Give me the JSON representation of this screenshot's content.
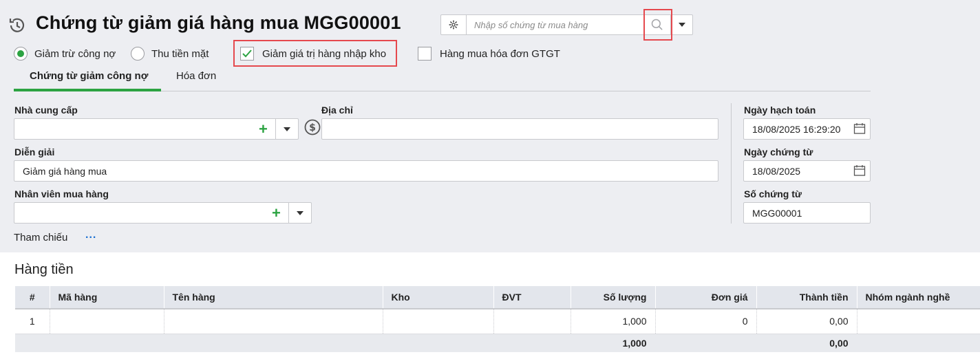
{
  "header": {
    "title": "Chứng từ giảm giá hàng mua MGG00001"
  },
  "search": {
    "placeholder": "Nhập số chứng từ mua hàng"
  },
  "options": {
    "radio_debt": "Giảm trừ công nợ",
    "radio_cash": "Thu tiền mặt",
    "check_stock": "Giảm giá trị hàng nhập kho",
    "check_vat": "Hàng mua hóa đơn GTGT",
    "radio_debt_selected": true,
    "check_stock_checked": true,
    "check_vat_checked": false
  },
  "tabs": [
    {
      "label": "Chứng từ giảm công nợ",
      "active": true
    },
    {
      "label": "Hóa đơn",
      "active": false
    }
  ],
  "form": {
    "supplier_label": "Nhà cung cấp",
    "supplier_value": "",
    "address_label": "Địa chỉ",
    "address_value": "",
    "description_label": "Diễn giải",
    "description_value": "Giảm giá hàng mua",
    "staff_label": "Nhân viên mua hàng",
    "staff_value": "",
    "posting_date_label": "Ngày hạch toán",
    "posting_date_value": "18/08/2025 16:29:20",
    "voucher_date_label": "Ngày chứng từ",
    "voucher_date_value": "18/08/2025",
    "voucher_no_label": "Số chứng từ",
    "voucher_no_value": "MGG00001",
    "reference_label": "Tham chiếu",
    "reference_more": "..."
  },
  "grid": {
    "title": "Hàng tiền",
    "columns": [
      "#",
      "Mã hàng",
      "Tên hàng",
      "Kho",
      "ĐVT",
      "Số lượng",
      "Đơn giá",
      "Thành tiền",
      "Nhóm ngành nghề"
    ],
    "rows": [
      [
        "1",
        "",
        "",
        "",
        "",
        "1,000",
        "0",
        "0,00",
        ""
      ]
    ],
    "totals": {
      "quantity": "1,000",
      "amount": "0,00"
    }
  },
  "colors": {
    "accent": "#2ca342",
    "highlight": "#e5484d",
    "link": "#1a6fd1"
  }
}
